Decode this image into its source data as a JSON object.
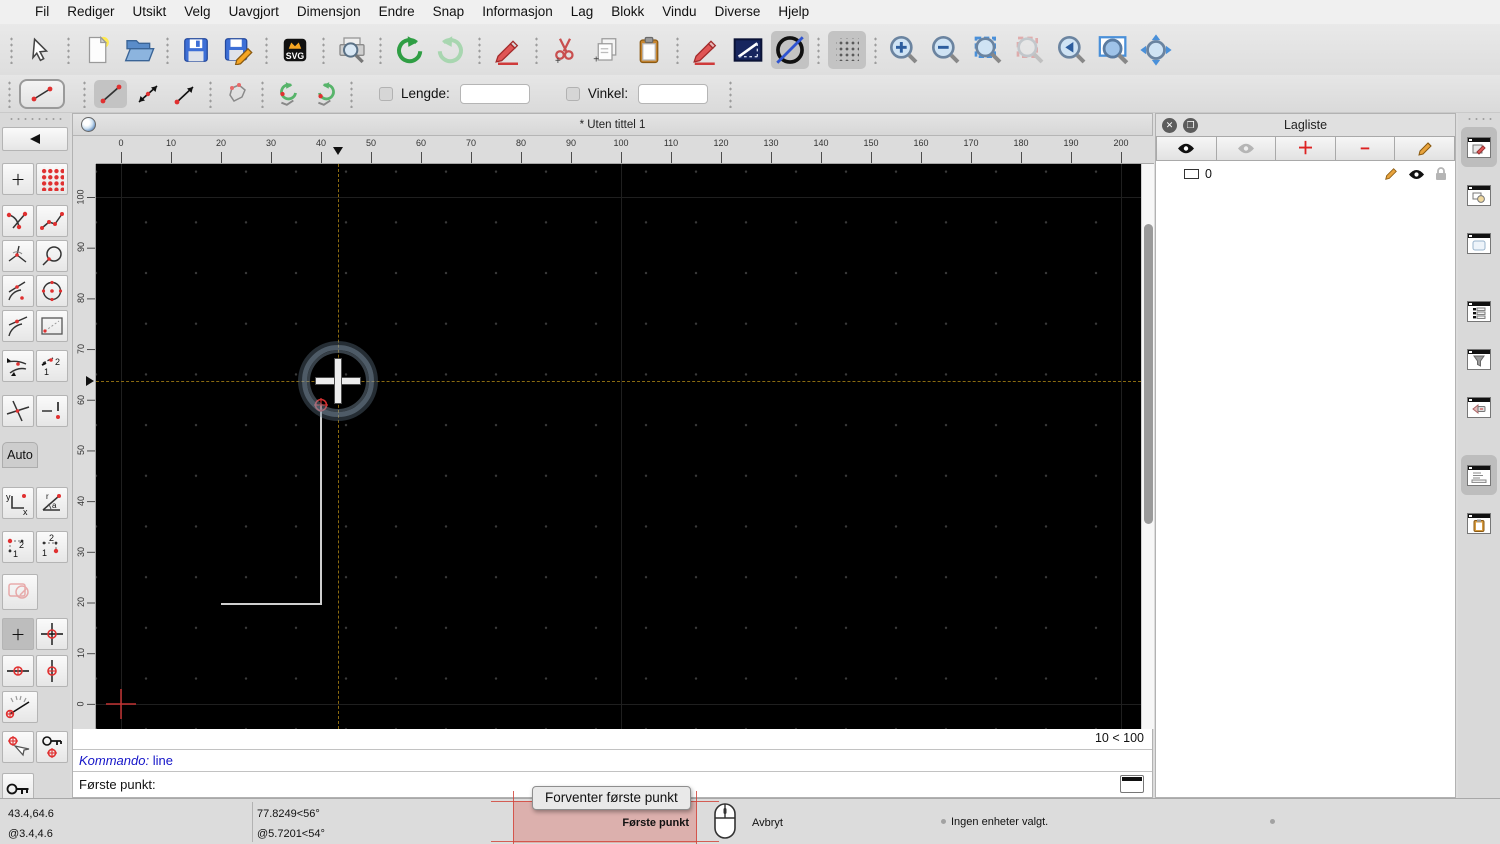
{
  "menu_bar": {
    "items": [
      "Fil",
      "Rediger",
      "Utsikt",
      "Velg",
      "Uavgjort",
      "Dimensjon",
      "Endre",
      "Snap",
      "Informasjon",
      "Lag",
      "Blokk",
      "Vindu",
      "Diverse",
      "Hjelp"
    ]
  },
  "icons": {
    "main_toolbar": [
      "select-pointer",
      "new-file",
      "open-file",
      "save",
      "save-as",
      "export-svg",
      "print-preview",
      "undo",
      "redo",
      "delete-selected",
      "cut",
      "copy",
      "paste",
      "pen-edit",
      "line-board",
      "circle-line",
      "grid-toggle",
      "zoom-in",
      "zoom-out",
      "zoom-auto",
      "zoom-previous",
      "zoom-back",
      "zoom-window",
      "zoom-pan"
    ],
    "line_toolbar": [
      "current-tool-line",
      "line-segment",
      "line-two-arrows",
      "line-arrow",
      "polyline",
      "undo-segment",
      "redo-segment"
    ],
    "left_toolbar": [
      "back",
      "snap-free",
      "snap-grid",
      "snap-endpoints",
      "snap-on-entity",
      "snap-center",
      "snap-circle",
      "snap-tangent",
      "snap-center-circle",
      "snap-middle",
      "snap-reference",
      "snap-intersection",
      "snap-intersection-manual",
      "snap-cross",
      "snap-nearest-warning",
      "coord-cartesian",
      "coord-polar",
      "points-order-12",
      "points-order-21",
      "selection-region",
      "restrict-free",
      "restrict-orthogonal",
      "restrict-horizontal",
      "restrict-vertical",
      "angle-gauge",
      "set-relative-zero",
      "lock-relative-zero",
      "key-lock"
    ],
    "layer_toolbar": [
      "show-all-eye",
      "hide-all-eye",
      "add-layer",
      "remove-layer",
      "edit-layer"
    ],
    "layer_row": [
      "layer-rect",
      "edit-pencil",
      "visible-eye",
      "lock-padlock"
    ],
    "right_dock": [
      "dock-layer-list",
      "dock-block-list",
      "dock-library-browser",
      "dock-entity-list",
      "dock-filter",
      "dock-view",
      "dock-command-line",
      "dock-clipboard"
    ]
  },
  "line_toolbar": {
    "length_label": "Lengde:",
    "length_value": "",
    "angle_label": "Vinkel:",
    "angle_value": ""
  },
  "left_toolbar": {
    "auto_label": "Auto"
  },
  "document": {
    "tab_title": "* Uten tittel 1",
    "grid_info": "10 < 100",
    "ruler_h": [
      "0",
      "10",
      "20",
      "30",
      "40",
      "50",
      "60",
      "70",
      "80",
      "90",
      "100",
      "110",
      "120",
      "130",
      "140",
      "150",
      "160",
      "170",
      "180",
      "190",
      "200"
    ],
    "ruler_v": [
      "0",
      "10",
      "20",
      "30",
      "40",
      "50",
      "60",
      "70",
      "80",
      "90",
      "100"
    ]
  },
  "layer_panel": {
    "title": "Lagliste",
    "layers": [
      {
        "name": "0"
      }
    ]
  },
  "command_panel": {
    "history_prefix": "Kommando:",
    "history_command": "line",
    "prompt": "Første punkt:"
  },
  "status_bar": {
    "coord_abs": "43.4,64.6",
    "coord_rel": "@3.4,4.6",
    "polar_abs": "77.8249<56°",
    "polar_rel": "@5.7201<54°",
    "left_button_hint": "Første punkt",
    "right_button_hint": "Avbryt",
    "selection_status": "Ingen enheter valgt.",
    "tooltip": "Forventer første punkt"
  },
  "colors": {
    "canvas_bg": "#000000",
    "snap_crosshair": "#8a6a10",
    "drawn_line": "#cfcfcf",
    "marker_red": "#cc2222",
    "command_text": "#1515c8",
    "hint_red": "#d2463c"
  }
}
